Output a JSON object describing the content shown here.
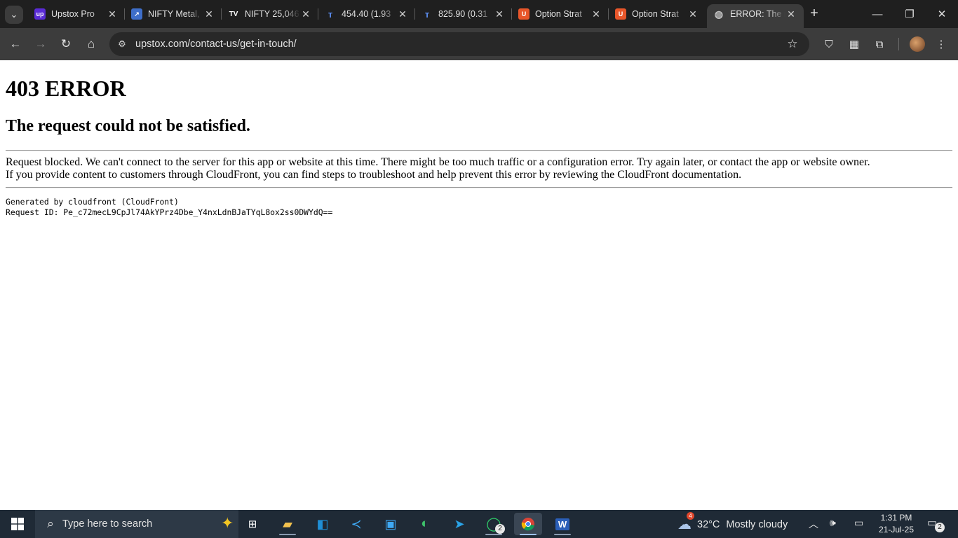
{
  "browser": {
    "tabs": [
      {
        "title": "Upstox Pro",
        "favicon": "upstox-icon",
        "active": false
      },
      {
        "title": "NIFTY Metal,",
        "favicon": "nifty-icon",
        "active": false
      },
      {
        "title": "NIFTY 25,046",
        "favicon": "tradingview-icon",
        "active": false
      },
      {
        "title": "454.40 (1.93",
        "favicon": "ticker-icon",
        "active": false
      },
      {
        "title": "825.90 (0.31",
        "favicon": "ticker-icon",
        "active": false
      },
      {
        "title": "Option Strat",
        "favicon": "option-strat-icon",
        "active": false
      },
      {
        "title": "Option Strat",
        "favicon": "option-strat-icon",
        "active": false
      },
      {
        "title": "ERROR: The r",
        "favicon": "globe-icon",
        "active": true
      }
    ],
    "url": "upstox.com/contact-us/get-in-touch/"
  },
  "page": {
    "heading": "403 ERROR",
    "subheading": "The request could not be satisfied.",
    "message_line1": "Request blocked. We can't connect to the server for this app or website at this time. There might be too much traffic or a configuration error. Try again later, or contact the app or website owner.",
    "message_line2": "If you provide content to customers through CloudFront, you can find steps to troubleshoot and help prevent this error by reviewing the CloudFront documentation.",
    "generated_by": "Generated by cloudfront (CloudFront)",
    "request_id": "Request ID: Pe_c72mecL9CpJl74AkYPrz4Dbe_Y4nxLdnBJaTYqL8ox2ss0DWYdQ=="
  },
  "taskbar": {
    "search_placeholder": "Type here to search",
    "whatsapp_badge": "2",
    "weather_badge": "4",
    "weather_temp": "32°C",
    "weather_desc": "Mostly cloudy",
    "time": "1:31 PM",
    "date": "21-Jul-25",
    "notifications": "2"
  }
}
